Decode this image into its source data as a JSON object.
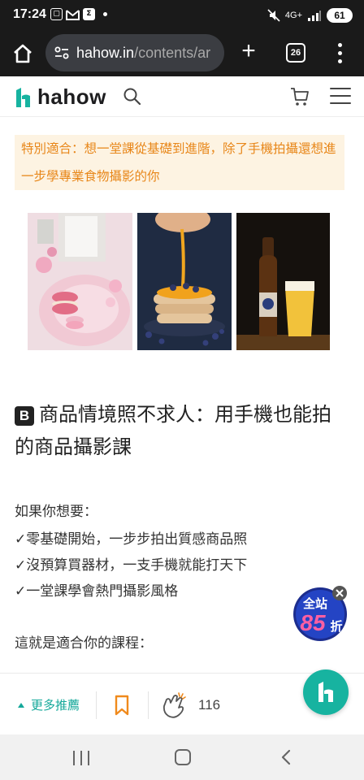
{
  "status_bar": {
    "time": "17:24",
    "network": "4G+",
    "battery": "61",
    "icons": [
      "screenshot-icon",
      "gmail-icon",
      "sigma-icon",
      "mute-icon",
      "signal-icon"
    ]
  },
  "browser": {
    "url_host": "hahow.in",
    "url_path": "/contents/ar",
    "tab_count": "26"
  },
  "site": {
    "logo_text": "hahow"
  },
  "content": {
    "highlight_text": "特別適合：想一堂課從基礎到進階，除了手機拍攝還想進一步學專業食物攝影的你",
    "photos": [
      "macarons-photo",
      "pancakes-photo",
      "beer-photo"
    ],
    "section_badge": "B",
    "section_title": "商品情境照不求人：用手機也能拍的商品攝影課",
    "intro": "如果你想要：",
    "checklist": [
      "✓零基礎開始，一步步拍出質感商品照",
      "✓沒預算買器材，一支手機就能打天下",
      "✓一堂課學會熱門攝影風格"
    ],
    "fit_text": "這就是適合你的課程："
  },
  "promo": {
    "line1": "全站",
    "number": "85",
    "suffix": "折"
  },
  "action_bar": {
    "more_label": "更多推薦",
    "clap_count": "116"
  },
  "colors": {
    "brand_teal": "#17b3a0",
    "highlight_bg": "#fdf3e2",
    "highlight_text": "#e8871a",
    "bookmark": "#f08a1c"
  }
}
